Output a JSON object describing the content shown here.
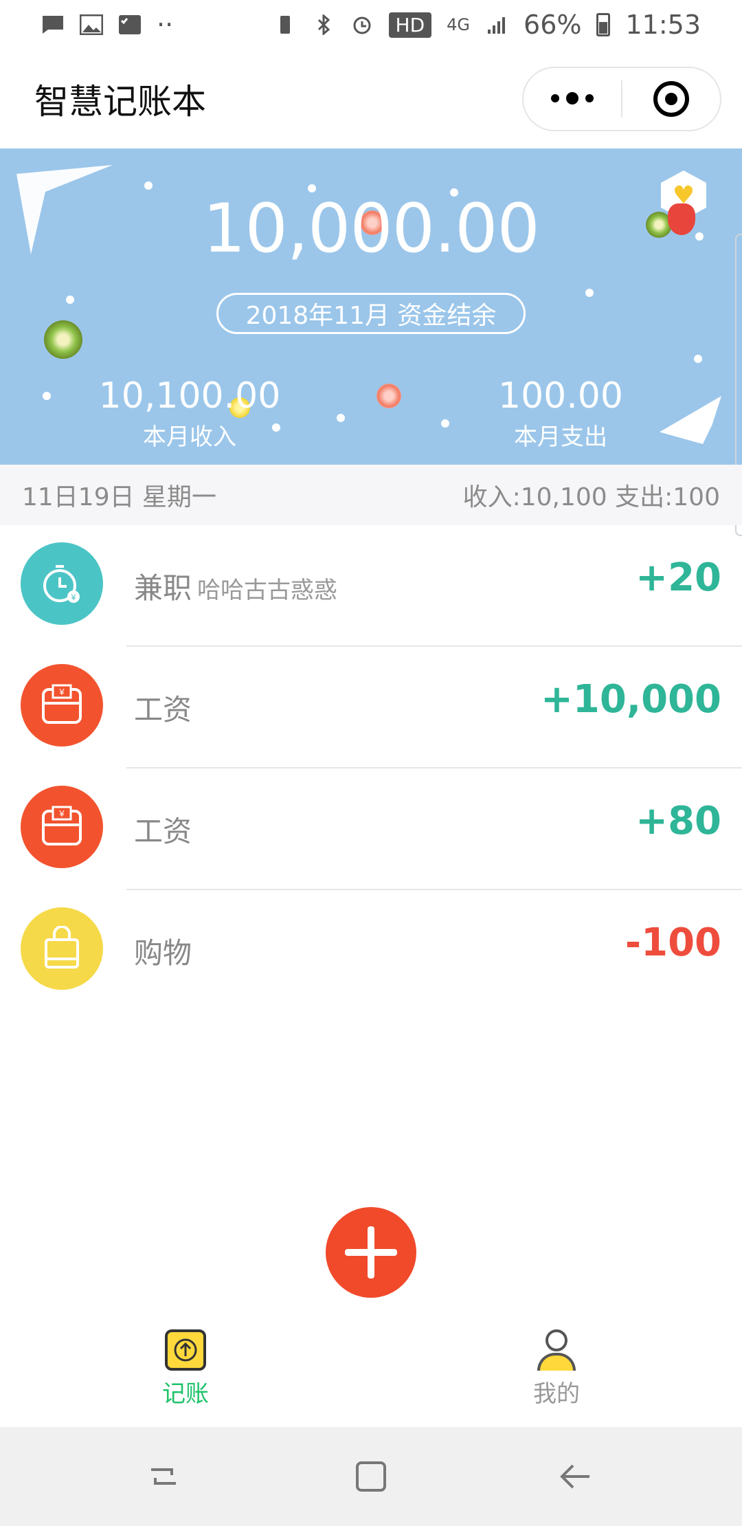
{
  "status_bar": {
    "battery": "66%",
    "network": "4G",
    "hd": "HD",
    "time": "11:53"
  },
  "app": {
    "title": "智慧记账本"
  },
  "summary": {
    "balance": "10,000.00",
    "period_label": "2018年11月 资金结余",
    "income_value": "10,100.00",
    "income_label": "本月收入",
    "expense_value": "100.00",
    "expense_label": "本月支出"
  },
  "day_header": {
    "date": "11日19日 星期一",
    "totals": "收入:10,100 支出:100"
  },
  "records": [
    {
      "category": "兼职",
      "note": "哈哈古古惑惑",
      "amount": "+20",
      "type": "income",
      "icon": "part-time-clock-icon",
      "color": "#4bc4c6"
    },
    {
      "category": "工资",
      "note": "",
      "amount": "+10,000",
      "type": "income",
      "icon": "salary-wallet-icon",
      "color": "#f2532e"
    },
    {
      "category": "工资",
      "note": "",
      "amount": "+80",
      "type": "income",
      "icon": "salary-wallet-icon",
      "color": "#f2532e"
    },
    {
      "category": "购物",
      "note": "",
      "amount": "-100",
      "type": "expense",
      "icon": "shopping-bag-icon",
      "color": "#f6d949"
    }
  ],
  "tabs": [
    {
      "label": "记账",
      "active": true,
      "icon": "bookkeeping-icon"
    },
    {
      "label": "我的",
      "active": false,
      "icon": "profile-icon"
    }
  ],
  "colors": {
    "hero_bg": "#9bc6ea",
    "income_green": "#2fb597",
    "expense_red": "#ee4d3d",
    "fab": "#f04a2b",
    "tab_active": "#1ec26a"
  }
}
